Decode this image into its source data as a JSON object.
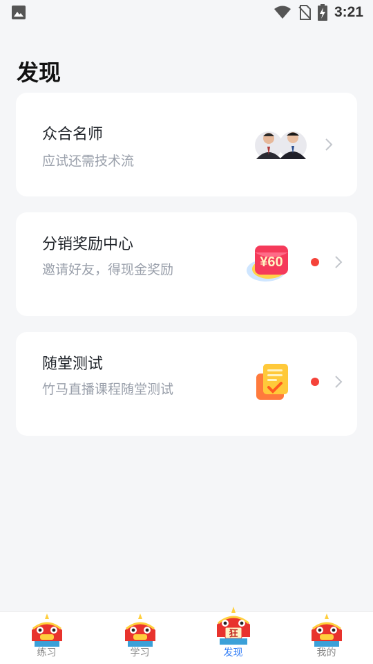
{
  "status_bar": {
    "time": "3:21",
    "icons": [
      "image-icon",
      "wifi-icon",
      "no-sim-icon",
      "battery-charging-icon"
    ]
  },
  "page": {
    "title": "发现"
  },
  "cards": [
    {
      "title": "众合名师",
      "subtitle": "应试还需技术流",
      "image": "teachers-avatars-icon",
      "has_dot": false
    },
    {
      "title": "分销奖励中心",
      "subtitle": "邀请好友，得现金奖励",
      "image": "red-envelope-icon",
      "image_text": "¥60",
      "has_dot": true
    },
    {
      "title": "随堂测试",
      "subtitle": "竹马直播课程随堂测试",
      "image": "test-paper-icon",
      "has_dot": true
    }
  ],
  "bottom_nav": {
    "items": [
      {
        "label": "练习",
        "icon": "lion-dance-icon",
        "active": false
      },
      {
        "label": "学习",
        "icon": "lion-dance-icon",
        "active": false
      },
      {
        "label": "发现",
        "icon": "lion-dance-icon",
        "active": true,
        "badge_text": "狂"
      },
      {
        "label": "我的",
        "icon": "lion-dance-icon",
        "active": false
      }
    ]
  },
  "colors": {
    "background": "#f5f6f8",
    "card": "#ffffff",
    "active_tab": "#2e7bf6",
    "dot": "#f5433a",
    "subtitle": "#9aa0ab"
  }
}
